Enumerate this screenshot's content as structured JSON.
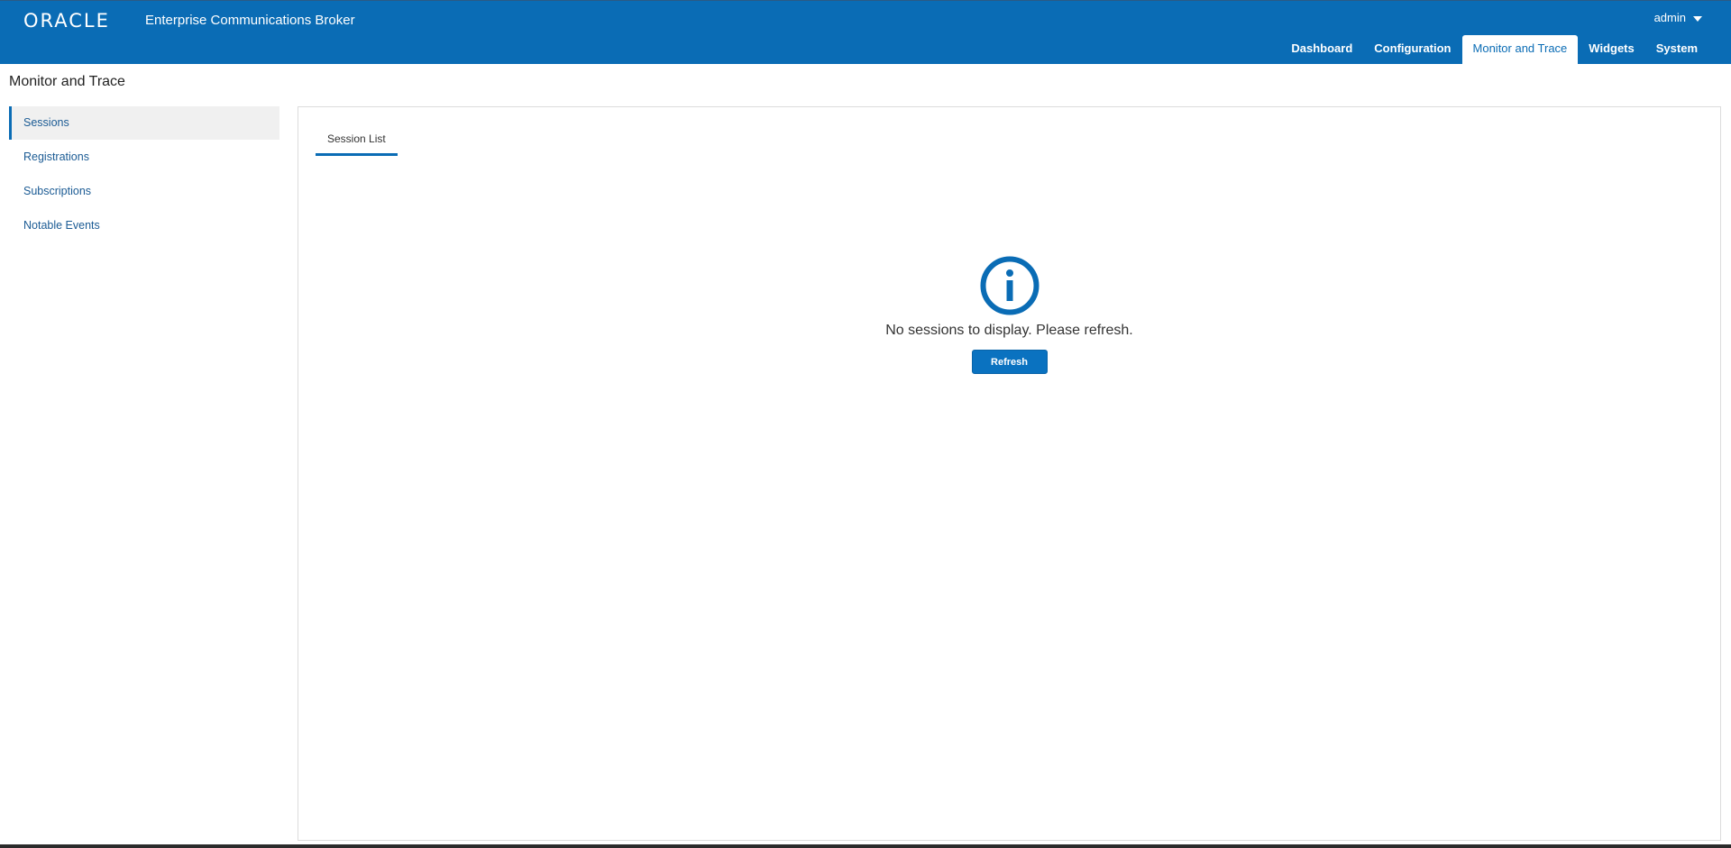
{
  "header": {
    "logo": "ORACLE",
    "app_title": "Enterprise Communications Broker",
    "user": "admin",
    "nav_tabs": [
      {
        "label": "Dashboard",
        "active": false
      },
      {
        "label": "Configuration",
        "active": false
      },
      {
        "label": "Monitor and Trace",
        "active": true
      },
      {
        "label": "Widgets",
        "active": false
      },
      {
        "label": "System",
        "active": false
      }
    ]
  },
  "page_title": "Monitor and Trace",
  "sidebar": {
    "items": [
      {
        "label": "Sessions",
        "active": true
      },
      {
        "label": "Registrations",
        "active": false
      },
      {
        "label": "Subscriptions",
        "active": false
      },
      {
        "label": "Notable Events",
        "active": false
      }
    ]
  },
  "main": {
    "tabs": [
      {
        "label": "Session List",
        "active": true
      }
    ],
    "empty_state": {
      "icon": "info-icon",
      "message": "No sessions to display. Please refresh.",
      "button_label": "Refresh"
    }
  },
  "colors": {
    "brand": "#0a6cb5",
    "link": "#1b5b94",
    "button": "#0a72c0"
  }
}
